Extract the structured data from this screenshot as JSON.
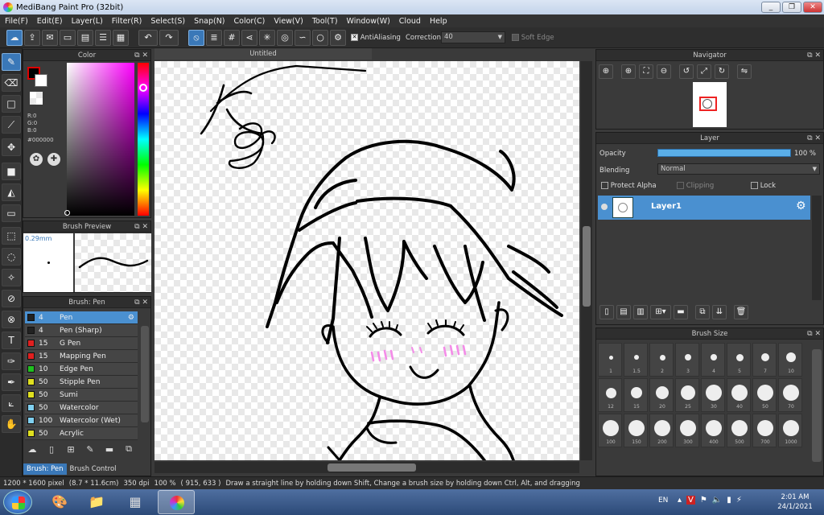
{
  "window": {
    "title": "MediBang Paint Pro (32bit)",
    "min": "_",
    "max": "❐",
    "close": "✕"
  },
  "menu": [
    "File(F)",
    "Edit(E)",
    "Layer(L)",
    "Filter(R)",
    "Select(S)",
    "Snap(N)",
    "Color(C)",
    "View(V)",
    "Tool(T)",
    "Window(W)",
    "Cloud",
    "Help"
  ],
  "toolbar": {
    "antialiasing_label": "AntiAliasing",
    "correction_label": "Correction",
    "correction_value": "40",
    "soft_edge_label": "Soft Edge"
  },
  "color_panel": {
    "title": "Color",
    "r": "R:0",
    "g": "G:0",
    "b": "B:0",
    "hex": "#000000"
  },
  "brush_preview": {
    "title": "Brush Preview",
    "size": "0.29mm"
  },
  "brush_panel": {
    "title": "Brush: Pen",
    "items": [
      {
        "size": "4",
        "name": "Pen",
        "color": "#222222",
        "selected": true
      },
      {
        "size": "4",
        "name": "Pen (Sharp)",
        "color": "#222222"
      },
      {
        "size": "15",
        "name": "G Pen",
        "color": "#e02020"
      },
      {
        "size": "15",
        "name": "Mapping Pen",
        "color": "#e02020"
      },
      {
        "size": "10",
        "name": "Edge Pen",
        "color": "#20c020"
      },
      {
        "size": "50",
        "name": "Stipple Pen",
        "color": "#e0e020"
      },
      {
        "size": "50",
        "name": "Sumi",
        "color": "#e0e020"
      },
      {
        "size": "50",
        "name": "Watercolor",
        "color": "#80d0f0"
      },
      {
        "size": "100",
        "name": "Watercolor (Wet)",
        "color": "#80d0f0"
      },
      {
        "size": "50",
        "name": "Acrylic",
        "color": "#e0e020"
      }
    ]
  },
  "bottom_tabs": {
    "tab1": "Brush: Pen",
    "tab2": "Brush Control"
  },
  "canvas": {
    "tab_title": "Untitled"
  },
  "navigator": {
    "title": "Navigator"
  },
  "layer_panel": {
    "title": "Layer",
    "opacity_label": "Opacity",
    "opacity_value": "100 %",
    "opacity_fraction": 1.0,
    "blending_label": "Blending",
    "blending_value": "Normal",
    "protect_alpha": "Protect Alpha",
    "clipping": "Clipping",
    "lock": "Lock",
    "layer_name": "Layer1"
  },
  "brush_size_panel": {
    "title": "Brush Size",
    "sizes": [
      "1",
      "1.5",
      "2",
      "3",
      "4",
      "5",
      "7",
      "10",
      "12",
      "15",
      "20",
      "25",
      "30",
      "40",
      "50",
      "70",
      "100",
      "150",
      "200",
      "300",
      "400",
      "500",
      "700",
      "1000"
    ]
  },
  "status": {
    "pixels": "1200 * 1600 pixel",
    "cm": "(8.7 * 11.6cm)",
    "dpi": "350 dpi",
    "zoom": "100 %",
    "coords": "( 915, 633 )",
    "hint": "Draw a straight line by holding down Shift, Change a brush size by holding down Ctrl, Alt, and dragging"
  },
  "taskbar": {
    "lang": "EN",
    "time": "2:01 AM",
    "date": "24/1/2021"
  }
}
